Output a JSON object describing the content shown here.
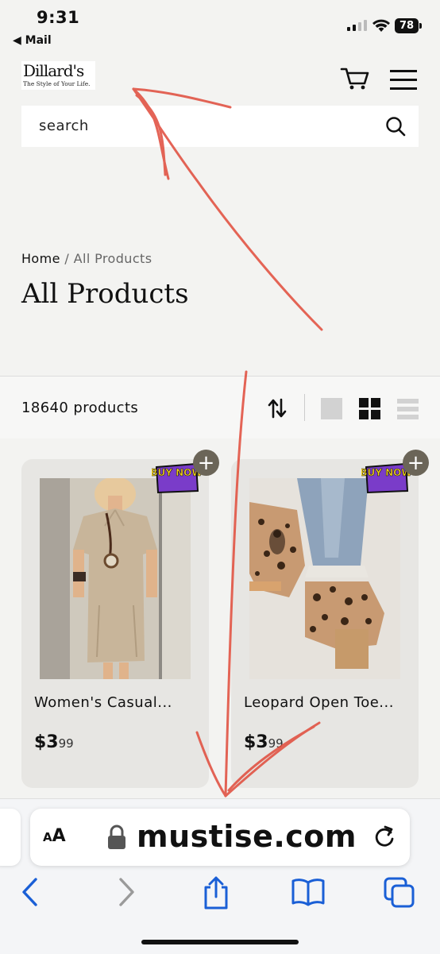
{
  "status_bar": {
    "time": "9:31",
    "back_app": "◀ Mail",
    "battery": "78"
  },
  "header": {
    "logo_brand": "Dillard's",
    "logo_tagline": "The Style of Your Life.",
    "cart_icon": "cart-icon",
    "menu_icon": "hamburger-menu-icon"
  },
  "search": {
    "placeholder": "search",
    "icon": "search-icon"
  },
  "breadcrumb": {
    "home": "Home",
    "separator": " / ",
    "current": "All Products"
  },
  "page_title": "All Products",
  "toolbar": {
    "count": "18640 products",
    "sort_icon": "sort-arrows-icon",
    "views": [
      "single-column-view-icon",
      "grid-view-icon",
      "list-view-icon"
    ],
    "selected_view": "grid-view-icon"
  },
  "products": [
    {
      "name": "Women's Casual...",
      "price_dollars": "$3",
      "price_cents": "99",
      "badge": "BUY NOW",
      "add": "+"
    },
    {
      "name": "Leopard Open Toe...",
      "price_dollars": "$3",
      "price_cents": "99",
      "badge": "BUY NOW",
      "add": "+"
    }
  ],
  "browser": {
    "aa_label_small": "A",
    "aa_label_big": "A",
    "domain": "mustise.com",
    "icons": [
      "lock-icon",
      "reload-icon",
      "back-icon",
      "forward-icon",
      "share-icon",
      "bookmarks-icon",
      "tabs-icon"
    ]
  },
  "colors": {
    "annotation": "#e04a3a",
    "accent_blue": "#1a5fd6",
    "plus_button": "#6b6558",
    "badge_purple": "#7a3cc9",
    "badge_yellow": "#f5d31c"
  }
}
